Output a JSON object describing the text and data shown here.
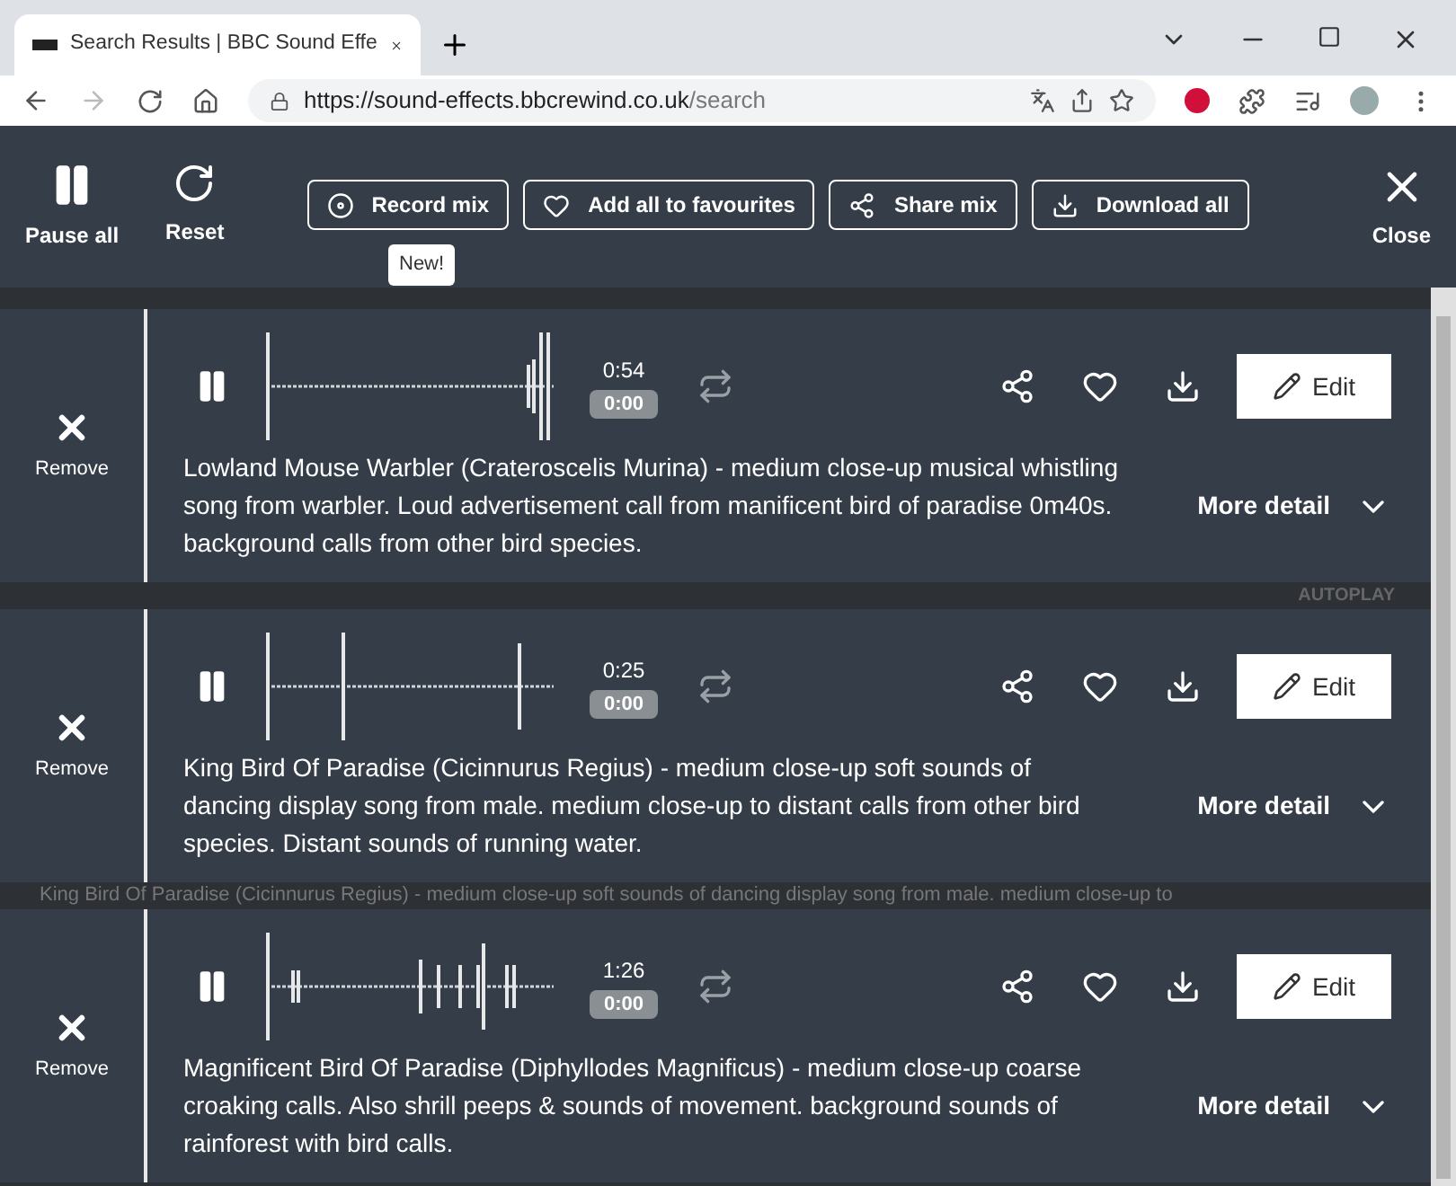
{
  "browser": {
    "tab_title": "Search Results | BBC Sound Effe",
    "url_host": "https://sound-effects.bbcrewind.co.uk",
    "url_path": "/search"
  },
  "toolbar": {
    "pause_all": "Pause all",
    "reset": "Reset",
    "actions": [
      {
        "kind": "record",
        "label": "Record mix"
      },
      {
        "kind": "favourite",
        "label": "Add all to favourites"
      },
      {
        "kind": "share",
        "label": "Share mix"
      },
      {
        "kind": "download",
        "label": "Download all"
      }
    ],
    "badge": "New!",
    "close": "Close"
  },
  "background": {
    "autoplay": "AUTOPLAY",
    "row_text": "King Bird Of Paradise (Cicinnurus Regius) - medium close-up soft sounds of dancing display song from male. medium close-up to"
  },
  "tracks": [
    {
      "remove": "Remove",
      "duration": "0:54",
      "position": "0:00",
      "description": "Lowland Mouse Warbler (Crateroscelis Murina) - medium close-up musical whistling song from warbler. Loud advertisement call from manificent bird of paradise 0m40s. background calls from other bird species.",
      "edit": "Edit",
      "more": "More detail"
    },
    {
      "remove": "Remove",
      "duration": "0:25",
      "position": "0:00",
      "description": "King Bird Of Paradise (Cicinnurus Regius) - medium close-up soft sounds of dancing display song from male. medium close-up to distant calls from other bird species. Distant sounds of running water.",
      "edit": "Edit",
      "more": "More detail"
    },
    {
      "remove": "Remove",
      "duration": "1:26",
      "position": "0:00",
      "description": "Magnificent Bird Of Paradise (Diphyllodes Magnificus) - medium close-up coarse croaking calls. Also shrill peeps & sounds of movement. background sounds of rainforest with bird calls.",
      "edit": "Edit",
      "more": "More detail"
    }
  ]
}
